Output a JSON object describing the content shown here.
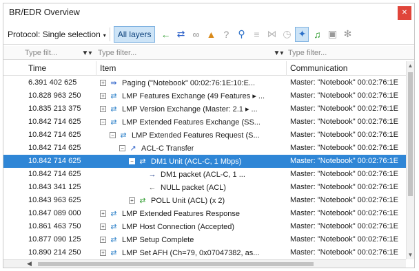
{
  "window": {
    "title": "BR/EDR Overview",
    "close_glyph": "✕"
  },
  "toolbar": {
    "protocol_label": "Protocol: Single selection",
    "protocol_arrow": "▾",
    "all_layers_label": "All layers",
    "icons": [
      {
        "name": "back-arrow-icon",
        "glyph": "←",
        "color": "#2a9a2a"
      },
      {
        "name": "swap-arrows-icon",
        "glyph": "⇄",
        "color": "#2a5fc8"
      },
      {
        "name": "link-icon",
        "glyph": "∞",
        "color": "#8a8a8a"
      },
      {
        "name": "hat-icon",
        "glyph": "▲",
        "color": "#d98a1a"
      },
      {
        "name": "info-icon",
        "glyph": "?",
        "color": "#9a9a9a"
      },
      {
        "name": "search-icon",
        "glyph": "⚲",
        "color": "#2a6fc8"
      },
      {
        "name": "filter-list-icon",
        "glyph": "≡",
        "color": "#b9b9b9"
      },
      {
        "name": "compare-icon",
        "glyph": "⋈",
        "color": "#b9b9b9"
      },
      {
        "name": "clock-icon",
        "glyph": "◷",
        "color": "#b9b9b9"
      },
      {
        "name": "pin-icon",
        "glyph": "✦",
        "color": "#2a6fc8",
        "active": true
      },
      {
        "name": "music-icon",
        "glyph": "♫",
        "color": "#2a9a2a"
      },
      {
        "name": "camera-icon",
        "glyph": "▣",
        "color": "#9a9a9a"
      },
      {
        "name": "settings-icon",
        "glyph": "✻",
        "color": "#9a9a9a"
      }
    ]
  },
  "filters": [
    {
      "placeholder": "Type filt..."
    },
    {
      "placeholder": "Type filter..."
    },
    {
      "placeholder": "Type filter..."
    }
  ],
  "columns": {
    "time": "Time",
    "item": "Item",
    "communication": "Communication"
  },
  "rows": [
    {
      "time": "6.391 402 625",
      "indent": 0,
      "expander": "+",
      "icon_glyph": "⇛",
      "icon_color": "#2a5fc8",
      "item": "Paging (\"Notebook\" 00:02:76:1E:10:E...",
      "comm": "Master: \"Notebook\" 00:02:76:1E"
    },
    {
      "time": "10.828 963 250",
      "indent": 0,
      "expander": "+",
      "icon_glyph": "⇄",
      "icon_color": "#2a7fc8",
      "item": "LMP Features Exchange (49 Features ▸ ...",
      "comm": "Master: \"Notebook\" 00:02:76:1E"
    },
    {
      "time": "10.835 213 375",
      "indent": 0,
      "expander": "+",
      "icon_glyph": "⇄",
      "icon_color": "#2a7fc8",
      "item": "LMP Version Exchange (Master: 2.1 ▸ ...",
      "comm": "Master: \"Notebook\" 00:02:76:1E"
    },
    {
      "time": "10.842 714 625",
      "indent": 0,
      "expander": "−",
      "icon_glyph": "⇄",
      "icon_color": "#2a7fc8",
      "item": "LMP Extended Features Exchange (SS...",
      "comm": "Master: \"Notebook\" 00:02:76:1E"
    },
    {
      "time": "10.842 714 625",
      "indent": 1,
      "expander": "−",
      "icon_glyph": "⇄",
      "icon_color": "#2a7fc8",
      "item": "LMP Extended Features Request (S...",
      "comm": "Master: \"Notebook\" 00:02:76:1E"
    },
    {
      "time": "10.842 714 625",
      "indent": 2,
      "expander": "−",
      "icon_glyph": "↗",
      "icon_color": "#2a5fc8",
      "item": "ACL-C Transfer",
      "comm": "Master: \"Notebook\" 00:02:76:1E"
    },
    {
      "time": "10.842 714 625",
      "indent": 3,
      "expander": "−",
      "icon_glyph": "⇄",
      "icon_color": "#ffffff",
      "item": "DM1 Unit (ACL-C, 1 Mbps)",
      "comm": "Master: \"Notebook\" 00:02:76:1E",
      "selected": true
    },
    {
      "time": "10.842 714 625",
      "indent": 4,
      "expander": "",
      "icon_glyph": "→",
      "icon_color": "#1a3a8a",
      "item": "DM1 packet (ACL-C, 1 ...",
      "comm": "Master: \"Notebook\" 00:02:76:1E"
    },
    {
      "time": "10.843 341 125",
      "indent": 4,
      "expander": "",
      "icon_glyph": "←",
      "icon_color": "#555555",
      "item": "NULL packet (ACL)",
      "comm": "Master: \"Notebook\" 00:02:76:1E"
    },
    {
      "time": "10.843 963 625",
      "indent": 3,
      "expander": "+",
      "icon_glyph": "⇄",
      "icon_color": "#2a9a2a",
      "item": "POLL Unit (ACL) (x 2)",
      "comm": "Master: \"Notebook\" 00:02:76:1E"
    },
    {
      "time": "10.847 089 000",
      "indent": 0,
      "expander": "+",
      "icon_glyph": "⇄",
      "icon_color": "#2a7fc8",
      "item": "LMP Extended Features Response",
      "comm": "Master: \"Notebook\" 00:02:76:1E"
    },
    {
      "time": "10.861 463 750",
      "indent": 0,
      "expander": "+",
      "icon_glyph": "⇄",
      "icon_color": "#2a7fc8",
      "item": "LMP Host Connection (Accepted)",
      "comm": "Master: \"Notebook\" 00:02:76:1E"
    },
    {
      "time": "10.877 090 125",
      "indent": 0,
      "expander": "+",
      "icon_glyph": "⇄",
      "icon_color": "#2a7fc8",
      "item": "LMP Setup Complete",
      "comm": "Master: \"Notebook\" 00:02:76:1E"
    },
    {
      "time": "10.890 214 250",
      "indent": 0,
      "expander": "+",
      "icon_glyph": "⇄",
      "icon_color": "#2a7fc8",
      "item": "LMP Set AFH (Ch=79, 0x07047382, as...",
      "comm": "Master: \"Notebook\" 00:02:76:1E"
    }
  ],
  "scrollbar": {
    "up": "▲",
    "down": "▼",
    "left": "◀"
  }
}
